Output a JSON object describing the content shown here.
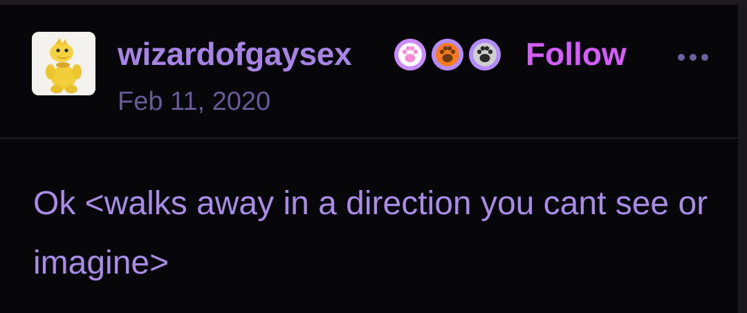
{
  "post": {
    "author": {
      "username": "wizardofgaysex",
      "avatar_icon": "yellow-plush-frog-avatar",
      "badges": [
        {
          "icon": "paw-print-icon",
          "background": "#c98bff",
          "paw_color": "#ff8ad8"
        },
        {
          "icon": "paw-print-icon",
          "background": "#ff7a1a",
          "paw_color": "#6b3a12"
        },
        {
          "icon": "paw-print-icon",
          "background": "#b48cff",
          "paw_color": "#2a2a2a"
        }
      ]
    },
    "follow_label": "Follow",
    "more_icon": "ellipsis-icon",
    "date": "Feb 11, 2020",
    "text": "Ok <walks away in a direction you cant see or imagine>"
  },
  "colors": {
    "background": "#070608",
    "username": "#a783e6",
    "follow": "#d65cff",
    "date": "#6a5a99",
    "body_text": "#a98be8"
  }
}
